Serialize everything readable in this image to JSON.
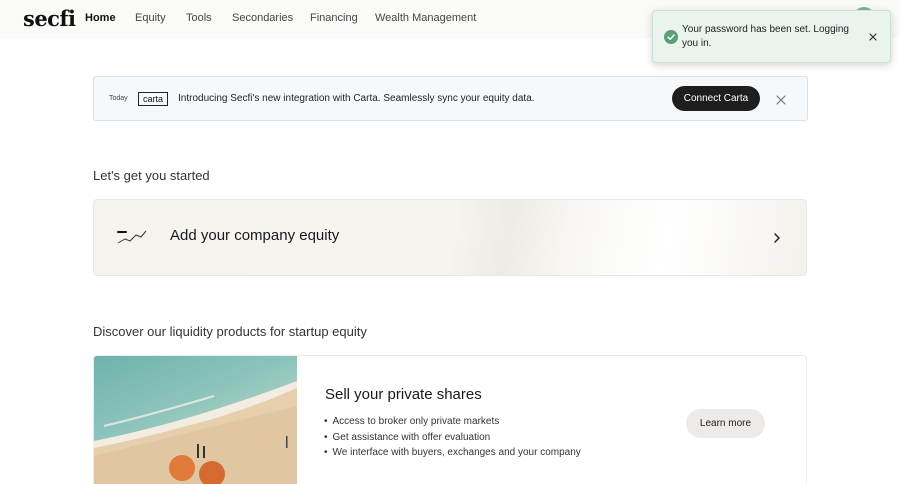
{
  "brand": {
    "logo_text": "secfi"
  },
  "nav": {
    "items": [
      {
        "label": "Home",
        "active": true
      },
      {
        "label": "Equity"
      },
      {
        "label": "Tools"
      },
      {
        "label": "Secondaries"
      },
      {
        "label": "Financing"
      },
      {
        "label": "Wealth Management"
      }
    ]
  },
  "toast": {
    "message": "Your password has been set. Logging you in.",
    "icon": "check-circle-icon",
    "color": "#5d9e73"
  },
  "announcement": {
    "date": "Today",
    "partner_logo": "carta",
    "text": "Introducing Secfi's new integration with Carta. Seamlessly sync your equity data.",
    "button_label": "Connect Carta"
  },
  "get_started": {
    "heading": "Let's get you started",
    "card_title": "Add your company equity"
  },
  "liquidity": {
    "heading": "Discover our liquidity products for startup equity",
    "card_title": "Sell your private shares",
    "bullets": [
      "Access to broker only private markets",
      "Get assistance with offer evaluation",
      "We interface with buyers, exchanges and your company"
    ],
    "button_label": "Learn more"
  }
}
